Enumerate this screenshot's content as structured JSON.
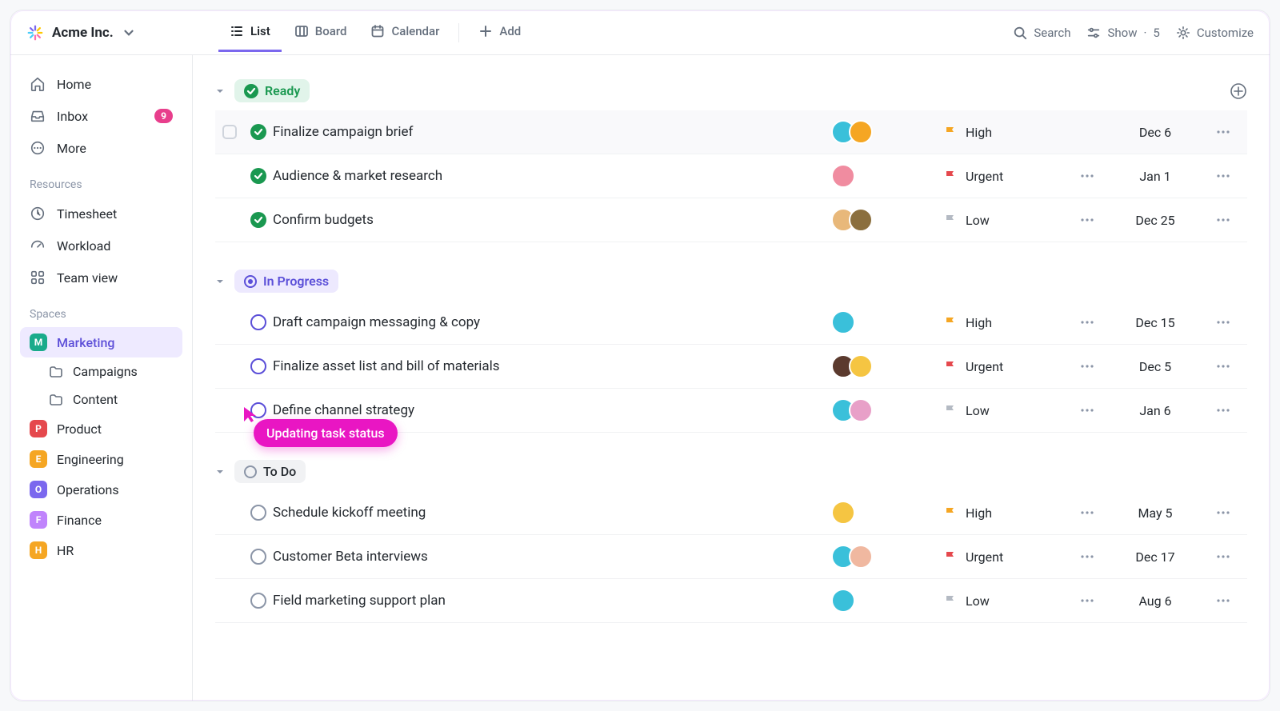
{
  "workspace": {
    "name": "Acme Inc."
  },
  "views": {
    "list": "List",
    "board": "Board",
    "calendar": "Calendar",
    "add": "Add"
  },
  "toolbar": {
    "search": "Search",
    "show": "Show",
    "show_count": "5",
    "customize": "Customize"
  },
  "sidebar": {
    "nav": {
      "home": "Home",
      "inbox": "Inbox",
      "inbox_badge": "9",
      "more": "More"
    },
    "resources_label": "Resources",
    "resources": {
      "timesheet": "Timesheet",
      "workload": "Workload",
      "teamview": "Team view"
    },
    "spaces_label": "Spaces",
    "spaces": [
      {
        "letter": "M",
        "name": "Marketing",
        "color": "#1aab8b",
        "active": true,
        "children": [
          {
            "name": "Campaigns"
          },
          {
            "name": "Content"
          }
        ]
      },
      {
        "letter": "P",
        "name": "Product",
        "color": "#e5484d"
      },
      {
        "letter": "E",
        "name": "Engineering",
        "color": "#f5a623"
      },
      {
        "letter": "O",
        "name": "Operations",
        "color": "#7b68ee"
      },
      {
        "letter": "F",
        "name": "Finance",
        "color": "#c084fc"
      },
      {
        "letter": "H",
        "name": "HR",
        "color": "#f5a623"
      }
    ]
  },
  "groups": [
    {
      "id": "ready",
      "label": "Ready",
      "pill_class": "ready",
      "icon": "check",
      "show_add": true,
      "tasks": [
        {
          "name": "Finalize campaign brief",
          "status": "done",
          "show_checkbox": true,
          "hover": true,
          "avatars": [
            {
              "bg": "#3ac0da"
            },
            {
              "bg": "#f5a623"
            }
          ],
          "priority": "High",
          "priority_class": "high",
          "date": "Dec 6",
          "show_mid_more": false
        },
        {
          "name": "Audience & market research",
          "status": "done",
          "avatars": [
            {
              "bg": "#f08ca0"
            }
          ],
          "priority": "Urgent",
          "priority_class": "urgent",
          "date": "Jan 1",
          "show_mid_more": true
        },
        {
          "name": "Confirm budgets",
          "status": "done",
          "avatars": [
            {
              "bg": "#e8b87a"
            },
            {
              "bg": "#8b6f3e"
            }
          ],
          "priority": "Low",
          "priority_class": "low",
          "date": "Dec 25",
          "show_mid_more": true
        }
      ]
    },
    {
      "id": "inprogress",
      "label": "In Progress",
      "pill_class": "inprogress",
      "icon": "dot",
      "tasks": [
        {
          "name": "Draft campaign messaging & copy",
          "status": "open",
          "avatars": [
            {
              "bg": "#3ac0da"
            }
          ],
          "priority": "High",
          "priority_class": "high",
          "date": "Dec 15",
          "show_mid_more": true
        },
        {
          "name": "Finalize asset list and bill of materials",
          "status": "open",
          "avatars": [
            {
              "bg": "#5b3a2e"
            },
            {
              "bg": "#f5c542"
            }
          ],
          "priority": "Urgent",
          "priority_class": "urgent",
          "date": "Dec 5",
          "show_mid_more": true
        },
        {
          "name": "Define channel strategy",
          "status": "open",
          "avatars": [
            {
              "bg": "#3ac0da"
            },
            {
              "bg": "#e8a0c8"
            }
          ],
          "priority": "Low",
          "priority_class": "low",
          "date": "Jan 6",
          "show_mid_more": true
        }
      ]
    },
    {
      "id": "todo",
      "label": "To Do",
      "pill_class": "todo",
      "icon": "circle",
      "tasks": [
        {
          "name": "Schedule kickoff meeting",
          "status": "open-grey",
          "avatars": [
            {
              "bg": "#f5c542"
            }
          ],
          "priority": "High",
          "priority_class": "high",
          "date": "May 5",
          "show_mid_more": true
        },
        {
          "name": "Customer Beta interviews",
          "status": "open-grey",
          "avatars": [
            {
              "bg": "#3ac0da"
            },
            {
              "bg": "#f0b8a0"
            }
          ],
          "priority": "Urgent",
          "priority_class": "urgent",
          "date": "Dec 17",
          "show_mid_more": true
        },
        {
          "name": "Field marketing support plan",
          "status": "open-grey",
          "avatars": [
            {
              "bg": "#3ac0da"
            }
          ],
          "priority": "Low",
          "priority_class": "low",
          "date": "Aug 6",
          "show_mid_more": true
        }
      ]
    }
  ],
  "cursor_tooltip": "Updating task status"
}
